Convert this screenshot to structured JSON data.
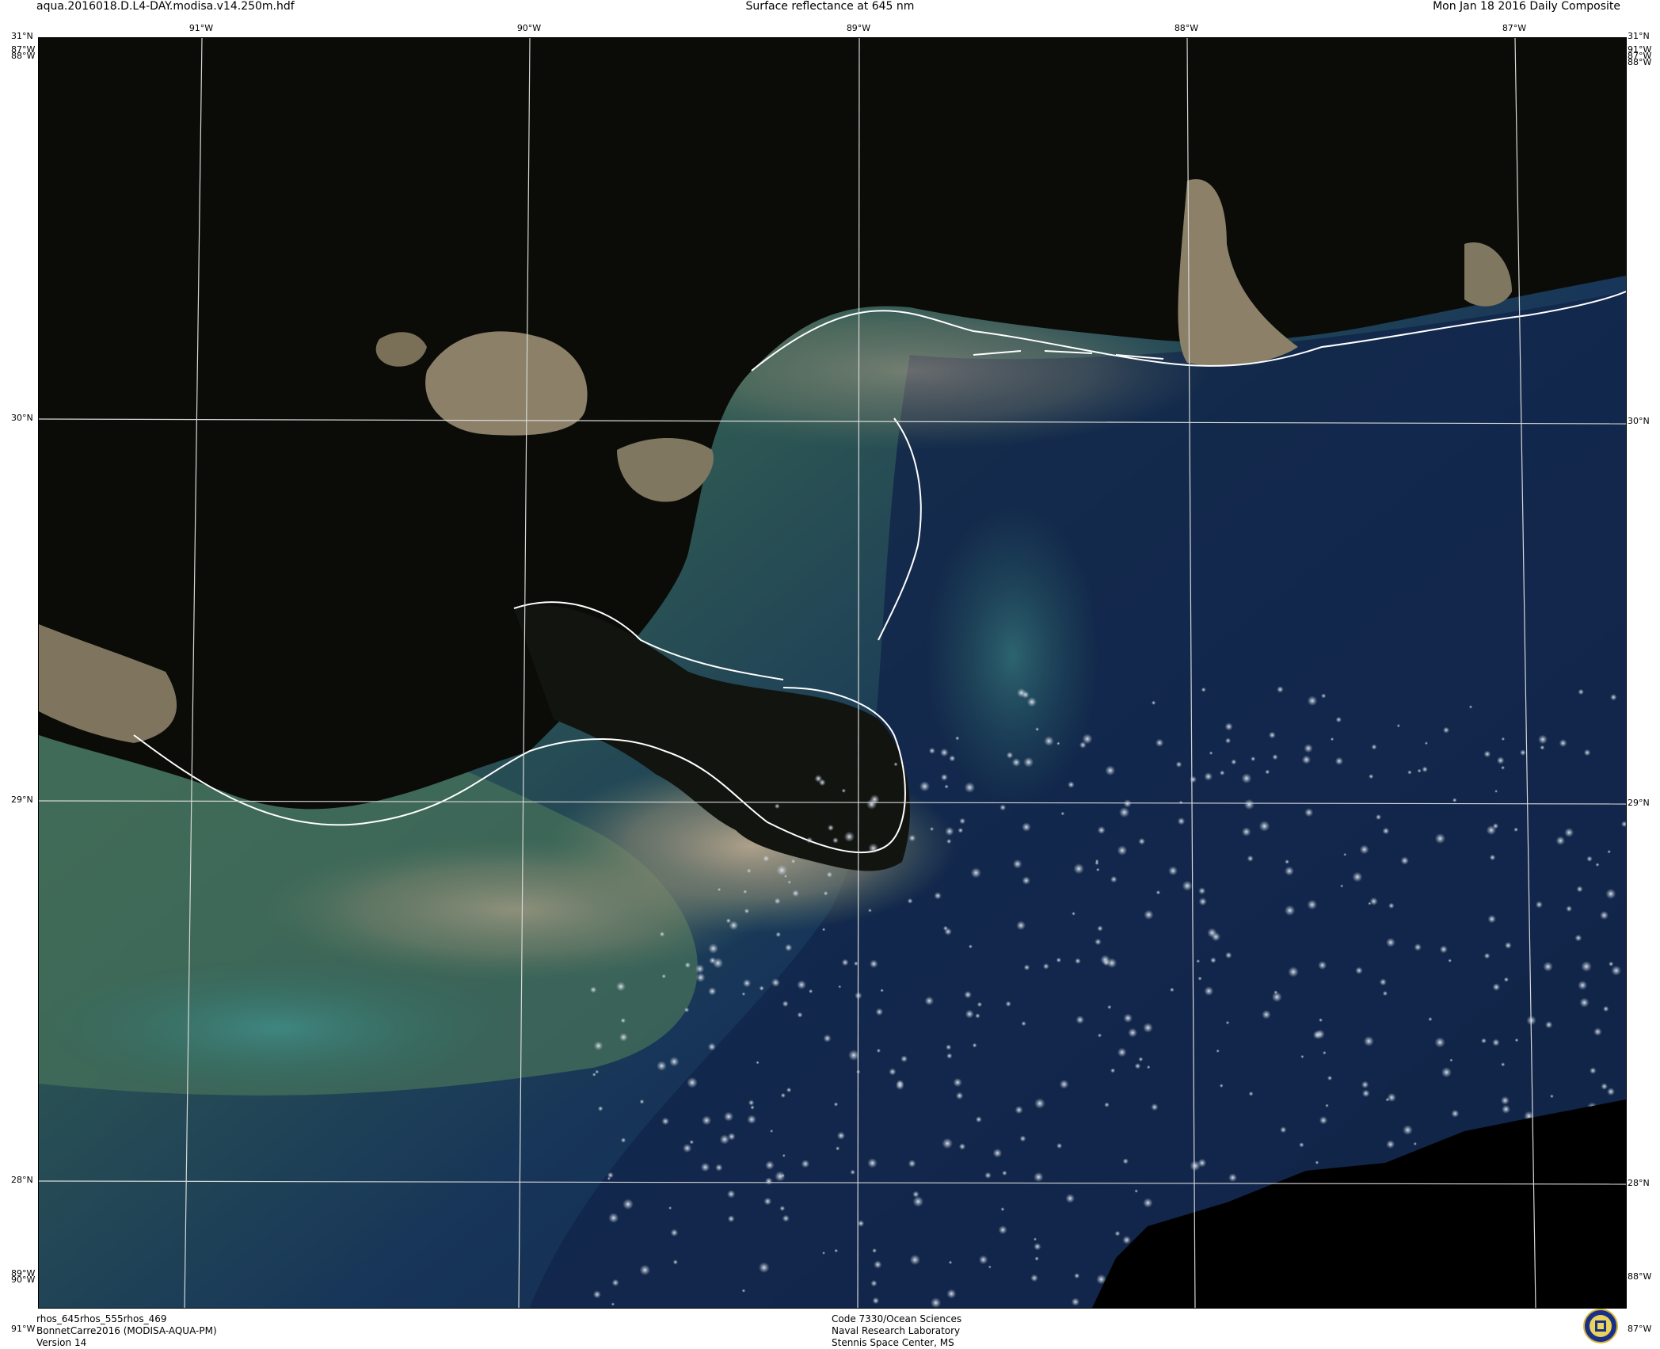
{
  "header": {
    "file_name": "aqua.2016018.D.L4-DAY.modisa.v14.250m.hdf",
    "product_title": "Surface reflectance at 645 nm",
    "composite_date": "Mon Jan 18 2016 Daily Composite"
  },
  "graticule": {
    "top_labels": [
      "31°N",
      "91°W",
      "90°W",
      "89°W",
      "88°W",
      "87°W",
      "31°N"
    ],
    "bottom_labels": [
      "91°W",
      "87°W"
    ],
    "left_labels": [
      "87°W",
      "88°W",
      "30°N",
      "29°N",
      "28°N",
      "89°W",
      "90°W"
    ],
    "right_labels": [
      "91°W",
      "87°W",
      "88°W",
      "30°N",
      "29°N",
      "28°N",
      "88°W"
    ]
  },
  "map": {
    "land_color": "#8c8068",
    "land_dark": "#0c0d09",
    "sediment_color": "#a99a84",
    "shelf_green": "#41664f",
    "deep_water": "#0f2040",
    "coastline_color": "#ffffff"
  },
  "footer": {
    "bands": "rhos_645rhos_555rhos_469",
    "project": "BonnetCarre2016 (MODISA-AQUA-PM)",
    "version": "Version 14",
    "org_code": "Code 7330/Ocean Sciences",
    "org_name": "Naval Research Laboratory",
    "org_location": "Stennis Space Center, MS"
  },
  "logo": {
    "icon": "nrl-seal-icon"
  }
}
